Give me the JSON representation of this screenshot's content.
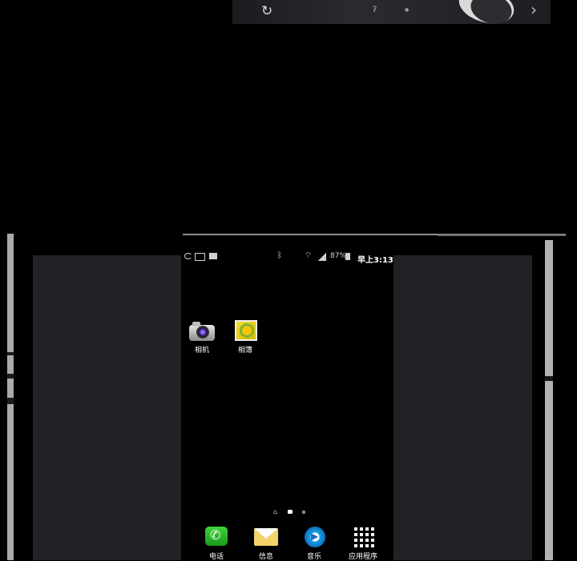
{
  "status_bar": {
    "battery_percent": "87%",
    "time": "早上3:13",
    "icons": [
      "sync-icon",
      "gallery-notification-icon",
      "store-notification-icon",
      "bluetooth-icon",
      "wifi-icon",
      "signal-icon",
      "battery-icon"
    ]
  },
  "home_apps": [
    {
      "label": "相机",
      "icon": "camera-icon"
    },
    {
      "label": "相簿",
      "icon": "album-icon"
    }
  ],
  "dock": [
    {
      "label": "电话",
      "icon": "phone-icon",
      "color": "#2fbf2c"
    },
    {
      "label": "信息",
      "icon": "message-icon",
      "color": "#f4d36a"
    },
    {
      "label": "音乐",
      "icon": "music-icon",
      "color": "#1c9ee6"
    },
    {
      "label": "应用程序",
      "icon": "apps-grid-icon",
      "color": "#ffffff"
    }
  ],
  "page_indicator": {
    "pages": 2,
    "current": 1
  },
  "colors": {
    "background": "#000000",
    "side_panel": "#222226",
    "frame": "#a8aca9"
  }
}
